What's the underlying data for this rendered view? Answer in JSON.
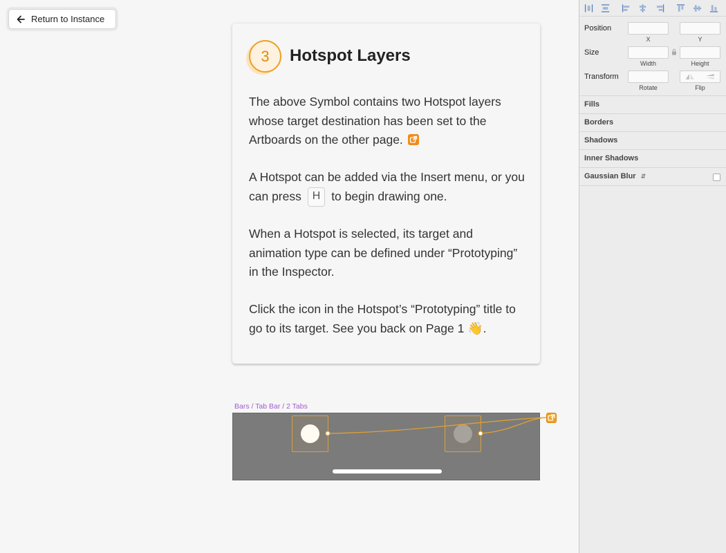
{
  "return_button": {
    "label": "Return to Instance"
  },
  "card": {
    "step_number": "3",
    "title": "Hotspot Layers",
    "p1": "The above Symbol contains two Hotspot layers whose target destination has been set to the Artboards on the other page.",
    "p2_before": "A Hotspot can be added via the Insert menu, or you can press",
    "p2_key": "H",
    "p2_after": "to begin drawing one.",
    "p3": "When a Hotspot is selected, its target and animation type can be defined under “Prototyping” in the Inspector.",
    "p4": "Click the icon in the Hotspot’s “Prototyping” title to go to its target. See you back on Page 1",
    "p4_emoji": "👋",
    "p4_end": "."
  },
  "artboard": {
    "label": "Bars / Tab Bar / 2 Tabs"
  },
  "inspector": {
    "position_label": "Position",
    "x_label": "X",
    "y_label": "Y",
    "size_label": "Size",
    "width_label": "Width",
    "height_label": "Height",
    "transform_label": "Transform",
    "rotate_label": "Rotate",
    "flip_label": "Flip",
    "sections": {
      "fills": "Fills",
      "borders": "Borders",
      "shadows": "Shadows",
      "inner_shadows": "Inner Shadows",
      "gaussian_blur": "Gaussian Blur"
    }
  },
  "colors": {
    "accent_orange": "#f0a024",
    "artboard_label": "#a05ad0",
    "artboard_bg": "#7b7b7b"
  }
}
